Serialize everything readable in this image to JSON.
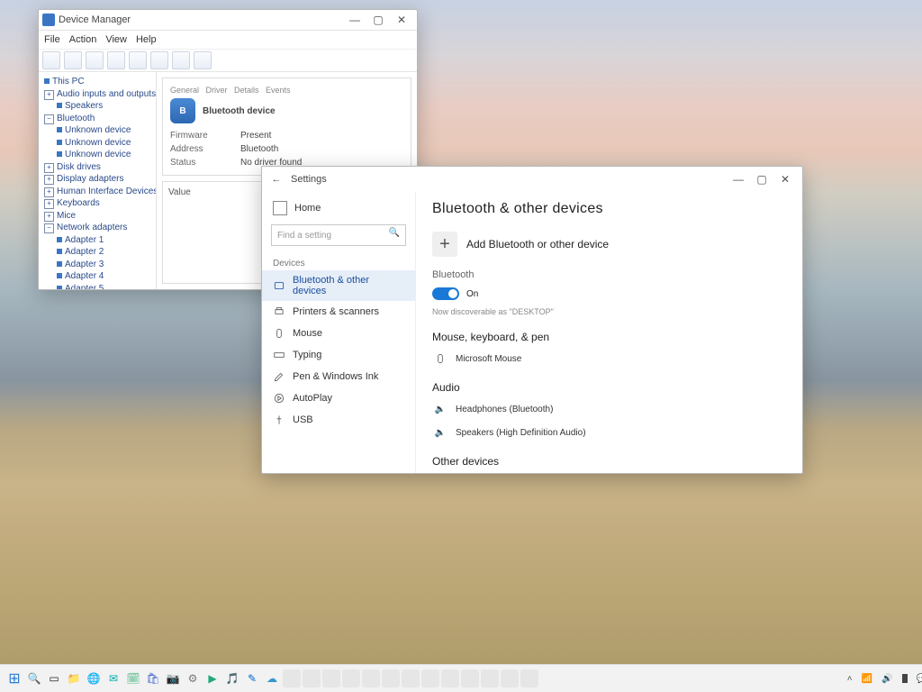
{
  "bgwin": {
    "title": "Device Manager",
    "menu": [
      "File",
      "Action",
      "View",
      "Help"
    ],
    "detail": {
      "name": "Bluetooth device",
      "rows": [
        {
          "k": "Firmware",
          "v": "Present"
        },
        {
          "k": "Address",
          "v": "Bluetooth"
        },
        {
          "k": "Status",
          "v": "No driver found"
        }
      ],
      "lower_label": "Value"
    },
    "tree": [
      {
        "t": "root",
        "label": "This PC"
      },
      {
        "t": "exp",
        "label": "Audio inputs and outputs"
      },
      {
        "t": "leaf",
        "label": "Speakers"
      },
      {
        "t": "exp",
        "label": "Bluetooth"
      },
      {
        "t": "leaf",
        "label": "Unknown device"
      },
      {
        "t": "leaf",
        "label": "Unknown device"
      },
      {
        "t": "leaf",
        "label": "Unknown device"
      },
      {
        "t": "exp",
        "label": "Disk drives"
      },
      {
        "t": "exp",
        "label": "Display adapters"
      },
      {
        "t": "exp",
        "label": "Human Interface Devices"
      },
      {
        "t": "exp",
        "label": "Keyboards"
      },
      {
        "t": "exp",
        "label": "Mice"
      },
      {
        "t": "exp",
        "label": "Network adapters"
      },
      {
        "t": "leaf",
        "label": "Adapter 1"
      },
      {
        "t": "leaf",
        "label": "Adapter 2"
      },
      {
        "t": "leaf",
        "label": "Adapter 3"
      },
      {
        "t": "leaf",
        "label": "Adapter 4"
      },
      {
        "t": "leaf",
        "label": "Adapter 5"
      }
    ]
  },
  "settings": {
    "title": "Settings",
    "home": "Home",
    "search_placeholder": "Find a setting",
    "side_heading": "Devices",
    "side_items": [
      {
        "label": "Bluetooth & other devices",
        "active": true
      },
      {
        "label": "Printers & scanners"
      },
      {
        "label": "Mouse"
      },
      {
        "label": "Typing"
      },
      {
        "label": "Pen & Windows Ink"
      },
      {
        "label": "AutoPlay"
      },
      {
        "label": "USB"
      }
    ],
    "page_heading": "Bluetooth & other devices",
    "add_label": "Add Bluetooth or other device",
    "bt_section": "Bluetooth",
    "bt_toggle": "On",
    "bt_note": "Now discoverable as \"DESKTOP\"",
    "mouse_heading": "Mouse, keyboard, & pen",
    "mouse_items": [
      "Microsoft Mouse"
    ],
    "audio_heading": "Audio",
    "audio_items": [
      "Headphones (Bluetooth)",
      "Speakers (High Definition Audio)"
    ],
    "other_heading": "Other devices"
  },
  "taskbar": {
    "tray_up": "˄"
  }
}
